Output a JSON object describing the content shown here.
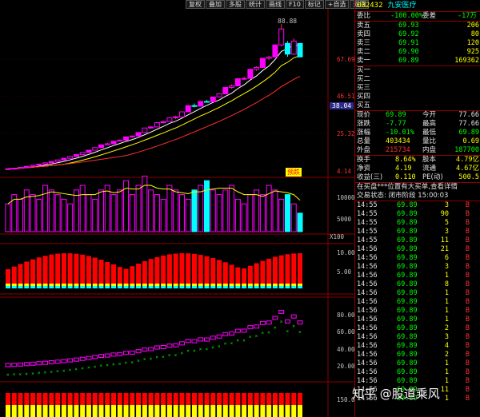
{
  "toolbar": {
    "buttons": [
      "复权",
      "叠加",
      "多股",
      "统计",
      "画线",
      "F10",
      "标记",
      "+自选",
      "返回"
    ]
  },
  "stock": {
    "code": "002432",
    "name": "九安医疗"
  },
  "price_axis": {
    "labels": [
      "67.69",
      "46.51",
      "25.32",
      "4.14"
    ],
    "high_label": "88.88",
    "current": "38.04",
    "badge": "预跌"
  },
  "volume_axis": {
    "labels": [
      "10000",
      "5000"
    ],
    "unit": "X100"
  },
  "macd_axis": {
    "labels": [
      "10.00",
      "5.00"
    ]
  },
  "kdj_axis": {
    "labels": [
      "80.00",
      "60.00",
      "40.00",
      "20.00"
    ]
  },
  "bottom_axis": {
    "labels": [
      "150.0"
    ]
  },
  "order_book": {
    "ratio": {
      "label1": "委比",
      "value1": "-100.00%",
      "label2": "委差",
      "value2": "-17万"
    },
    "sells": [
      {
        "label": "卖五",
        "price": "69.93",
        "vol": "206"
      },
      {
        "label": "卖四",
        "price": "69.92",
        "vol": "80"
      },
      {
        "label": "卖三",
        "price": "69.91",
        "vol": "120"
      },
      {
        "label": "卖二",
        "price": "69.90",
        "vol": "925"
      },
      {
        "label": "卖一",
        "price": "69.89",
        "vol": "169362"
      }
    ],
    "buys": [
      {
        "label": "买一"
      },
      {
        "label": "买二"
      },
      {
        "label": "买三"
      },
      {
        "label": "买四"
      },
      {
        "label": "买五"
      }
    ]
  },
  "quote": [
    {
      "l1": "现价",
      "v1": "69.89",
      "l2": "今开",
      "v2": "77.66",
      "c1": "g",
      "c2": "w"
    },
    {
      "l1": "涨跌",
      "v1": "-7.77",
      "l2": "最高",
      "v2": "77.66",
      "c1": "g",
      "c2": "w"
    },
    {
      "l1": "涨幅",
      "v1": "-10.01%",
      "l2": "最低",
      "v2": "69.89",
      "c1": "g",
      "c2": "g"
    },
    {
      "l1": "总量",
      "v1": "403434",
      "l2": "量比",
      "v2": "0.69",
      "c1": "y",
      "c2": "y"
    },
    {
      "l1": "外盘",
      "v1": "215734",
      "l2": "内盘",
      "v2": "187700",
      "c1": "r",
      "c2": "g"
    }
  ],
  "stats": [
    {
      "l1": "换手",
      "v1": "8.64%",
      "l2": "股本",
      "v2": "4.79亿"
    },
    {
      "l1": "净资",
      "v1": "4.19",
      "l2": "流通",
      "v2": "4.67亿"
    },
    {
      "l1": "收益(三)",
      "v1": "0.110",
      "l2": "PE(动)",
      "v2": "500.5"
    }
  ],
  "notices": [
    "在买盘***位置有大买单,查看详情",
    "交易状态: 闭市阶段 15:00:03"
  ],
  "ticks": [
    {
      "t": "14:55",
      "p": "69.89",
      "v": "3",
      "s": "B"
    },
    {
      "t": "14:55",
      "p": "69.89",
      "v": "90",
      "s": "B"
    },
    {
      "t": "14:55",
      "p": "69.89",
      "v": "5",
      "s": "B"
    },
    {
      "t": "14:55",
      "p": "69.89",
      "v": "3",
      "s": "B"
    },
    {
      "t": "14:55",
      "p": "69.89",
      "v": "11",
      "s": "B"
    },
    {
      "t": "14:56",
      "p": "69.89",
      "v": "21",
      "s": "B"
    },
    {
      "t": "14:56",
      "p": "69.89",
      "v": "6",
      "s": "B"
    },
    {
      "t": "14:56",
      "p": "69.89",
      "v": "3",
      "s": "B"
    },
    {
      "t": "14:56",
      "p": "69.89",
      "v": "1",
      "s": "B"
    },
    {
      "t": "14:56",
      "p": "69.89",
      "v": "8",
      "s": "B"
    },
    {
      "t": "14:56",
      "p": "69.89",
      "v": "1",
      "s": "B"
    },
    {
      "t": "14:56",
      "p": "69.89",
      "v": "1",
      "s": "B"
    },
    {
      "t": "14:56",
      "p": "69.89",
      "v": "1",
      "s": "B"
    },
    {
      "t": "14:56",
      "p": "69.89",
      "v": "1",
      "s": "B"
    },
    {
      "t": "14:56",
      "p": "69.89",
      "v": "2",
      "s": "B"
    },
    {
      "t": "14:56",
      "p": "69.89",
      "v": "3",
      "s": "B"
    },
    {
      "t": "14:56",
      "p": "69.89",
      "v": "4",
      "s": "B"
    },
    {
      "t": "14:56",
      "p": "69.89",
      "v": "2",
      "s": "B"
    },
    {
      "t": "14:56",
      "p": "69.89",
      "v": "1",
      "s": "B"
    },
    {
      "t": "14:56",
      "p": "69.89",
      "v": "1",
      "s": "B"
    },
    {
      "t": "14:56",
      "p": "69.89",
      "v": "1",
      "s": "B"
    },
    {
      "t": "14:56",
      "p": "69.89",
      "v": "11",
      "s": "B"
    },
    {
      "t": "14:56",
      "p": "69.89",
      "v": "1",
      "s": "B"
    }
  ],
  "watermark": "知乎 @股道乘风",
  "colors": {
    "up": "#ff3030",
    "down": "#00ffff",
    "up_fill": "#ff00ff",
    "grid": "#8b0000"
  },
  "chart_data": {
    "type": "candlestick",
    "price_ylim": [
      4.14,
      88.88
    ],
    "candles": [
      [
        5.2,
        5.5,
        5.0,
        5.4
      ],
      [
        5.4,
        5.8,
        5.3,
        5.7
      ],
      [
        5.7,
        6.3,
        5.6,
        6.2
      ],
      [
        6.2,
        6.9,
        6.1,
        6.8
      ],
      [
        6.8,
        7.5,
        6.7,
        7.4
      ],
      [
        7.4,
        8.2,
        7.3,
        8.1
      ],
      [
        8.1,
        8.9,
        8.0,
        8.8
      ],
      [
        8.8,
        9.7,
        8.7,
        9.6
      ],
      [
        9.6,
        10.6,
        9.5,
        10.5
      ],
      [
        10.5,
        11.5,
        10.4,
        11.4
      ],
      [
        11.4,
        12.6,
        11.3,
        12.5
      ],
      [
        12.5,
        13.7,
        12.4,
        13.6
      ],
      [
        13.6,
        14.9,
        13.5,
        14.8
      ],
      [
        14.8,
        16.3,
        14.7,
        16.1
      ],
      [
        16.1,
        17.7,
        16.0,
        17.6
      ],
      [
        17.6,
        19.3,
        17.5,
        19.2
      ],
      [
        19.2,
        20.5,
        19.0,
        19.8
      ],
      [
        19.8,
        21.5,
        19.6,
        21.3
      ],
      [
        21.3,
        22.4,
        21.0,
        21.9
      ],
      [
        21.9,
        24.0,
        21.7,
        23.8
      ],
      [
        23.8,
        24.5,
        23.2,
        24.3
      ],
      [
        24.3,
        26.5,
        24.2,
        26.3
      ],
      [
        26.3,
        29.0,
        26.2,
        28.9
      ],
      [
        28.9,
        30.0,
        28.5,
        29.5
      ],
      [
        29.5,
        32.3,
        29.4,
        32.0
      ],
      [
        32.0,
        33.0,
        31.5,
        32.6
      ],
      [
        32.6,
        35.0,
        32.5,
        34.8
      ],
      [
        34.8,
        36.0,
        34.0,
        35.3
      ],
      [
        35.3,
        38.5,
        35.2,
        38.2
      ],
      [
        38.2,
        42.0,
        38.1,
        41.8
      ],
      [
        41.8,
        43.0,
        40.8,
        41.5
      ],
      [
        41.5,
        44.5,
        41.3,
        44.2
      ],
      [
        44.2,
        45.0,
        43.5,
        44.0
      ],
      [
        44.0,
        47.0,
        43.8,
        46.8
      ],
      [
        46.8,
        49.0,
        46.5,
        48.6
      ],
      [
        48.6,
        52.5,
        48.5,
        52.3
      ],
      [
        52.3,
        54.0,
        51.5,
        53.2
      ],
      [
        53.2,
        57.5,
        53.0,
        57.3
      ],
      [
        57.3,
        58.5,
        56.5,
        57.5
      ],
      [
        57.5,
        63.0,
        57.4,
        62.7
      ],
      [
        62.7,
        64.5,
        61.8,
        63.8
      ],
      [
        63.8,
        69.5,
        63.7,
        69.1
      ],
      [
        69.1,
        70.5,
        68.0,
        69.8
      ],
      [
        69.8,
        77.0,
        69.7,
        76.8
      ],
      [
        76.8,
        88.88,
        76.0,
        86.0
      ],
      [
        77.66,
        79.0,
        70.0,
        71.5
      ],
      [
        71.5,
        80.5,
        71.0,
        79.0
      ],
      [
        77.66,
        77.66,
        69.89,
        69.89
      ]
    ],
    "volumes": [
      600,
      800,
      700,
      900,
      800,
      700,
      1000,
      900,
      800,
      700,
      600,
      900,
      1000,
      800,
      700,
      900,
      1000,
      800,
      900,
      1100,
      800,
      1000,
      1200,
      900,
      800,
      700,
      1000,
      900,
      800,
      700,
      900,
      1000,
      1100,
      900,
      800,
      900,
      1000,
      700,
      600,
      800,
      900,
      800,
      1000,
      900,
      700,
      800,
      600,
      400
    ]
  }
}
